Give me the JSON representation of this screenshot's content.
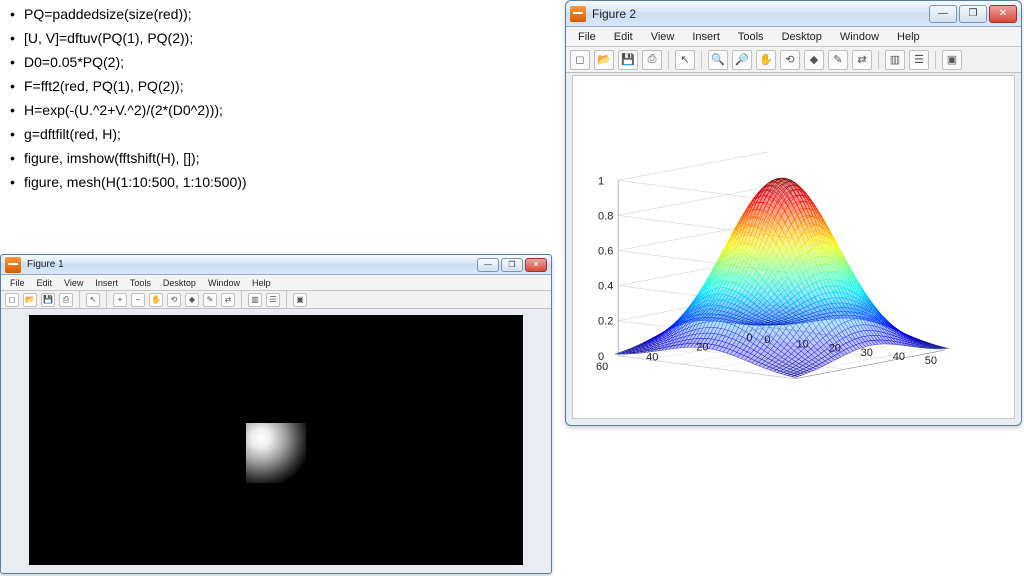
{
  "code": [
    "PQ=paddedsize(size(red));",
    "[U, V]=dftuv(PQ(1), PQ(2));",
    "D0=0.05*PQ(2);",
    "F=fft2(red, PQ(1), PQ(2));",
    "H=exp(-(U.^2+V.^2)/(2*(D0^2)));",
    "g=dftfilt(red, H);",
    "figure, imshow(fftshift(H), []);",
    "figure, mesh(H(1:10:500, 1:10:500))"
  ],
  "fig1": {
    "title": "Figure 1"
  },
  "fig2": {
    "title": "Figure 2"
  },
  "menus": [
    "File",
    "Edit",
    "View",
    "Insert",
    "Tools",
    "Desktop",
    "Window",
    "Help"
  ],
  "winbtns": {
    "min": "—",
    "max": "❐",
    "close": "✕"
  },
  "chart_data": {
    "type": "surface",
    "title": "",
    "xlabel": "",
    "ylabel": "",
    "zlabel": "",
    "xlim": [
      0,
      55
    ],
    "ylim": [
      0,
      60
    ],
    "zlim": [
      0,
      1
    ],
    "xticks": [
      0,
      10,
      20,
      30,
      40,
      50
    ],
    "yticks": [
      0,
      20,
      40,
      60
    ],
    "zticks": [
      0,
      0.2,
      0.4,
      0.6,
      0.8,
      1
    ],
    "description": "Gaussian low-pass filter H sampled on 50×50 grid (every 10th of 500), peak ≈1 near center decaying toward edges"
  }
}
